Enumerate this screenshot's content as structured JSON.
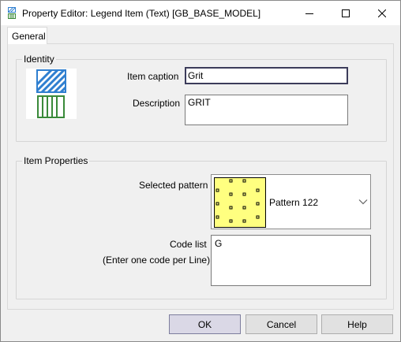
{
  "window": {
    "title": "Property Editor: Legend Item (Text) [GB_BASE_MODEL]",
    "app_icon": "legend-editor-icon",
    "controls": {
      "minimize_icon": "minimize-icon",
      "maximize_icon": "maximize-icon",
      "close_icon": "close-icon"
    }
  },
  "tabs": [
    {
      "label": "General",
      "selected": true
    }
  ],
  "identity": {
    "group_label": "Identity",
    "item_caption_label": "Item caption",
    "item_caption_value": "Grit",
    "description_label": "Description",
    "description_value": "GRIT",
    "preview_icons": [
      "diagonal-hatch-icon",
      "vertical-stripe-icon"
    ]
  },
  "item_properties": {
    "group_label": "Item Properties",
    "selected_pattern_label": "Selected pattern",
    "selected_pattern_value": "Pattern 122",
    "pattern_swatch_color": "#ffff80",
    "code_list_label": "Code list",
    "code_list_hint": "(Enter one code per Line)",
    "code_list_value": "G"
  },
  "buttons": {
    "ok": "OK",
    "cancel": "Cancel",
    "help": "Help"
  },
  "colors": {
    "hatch_blue": "#2f7fd0",
    "stripe_green": "#3a8a3a",
    "ok_button_bg": "#dad8e6",
    "active_input_border": "#3c3c5a"
  }
}
